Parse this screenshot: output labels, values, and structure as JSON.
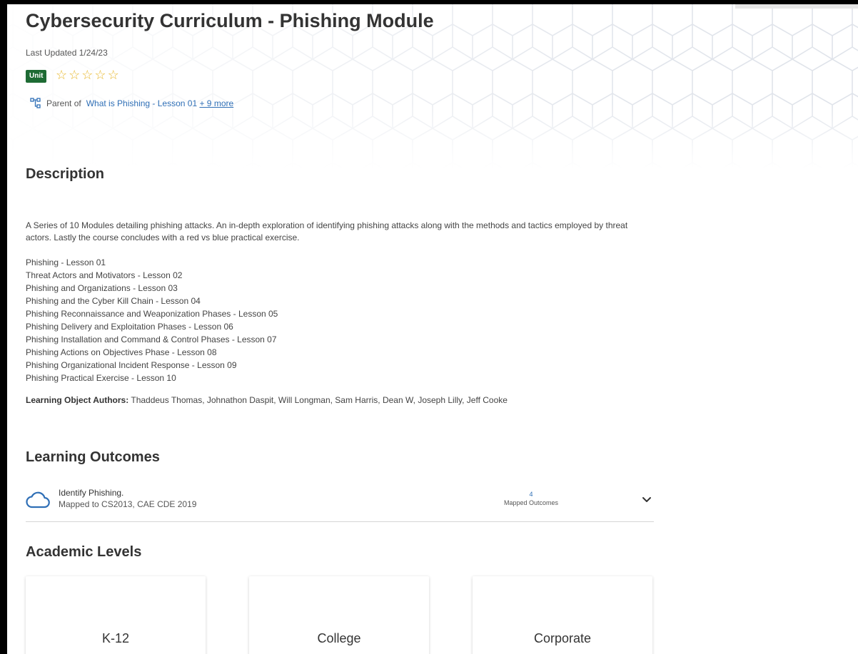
{
  "header": {
    "title": "Cybersecurity Curriculum - Phishing Module",
    "last_updated": "Last Updated 1/24/23",
    "badge": "Unit",
    "rating": {
      "value": 0,
      "max": 5
    },
    "parent_prefix": "Parent of",
    "parent_link": "What is Phishing - Lesson 01",
    "more_link": "+ 9 more"
  },
  "description": {
    "heading": "Description",
    "summary": "A Series of 10 Modules detailing phishing attacks. An in-depth exploration of identifying phishing attacks along with the methods and tactics employed by threat actors. Lastly the course concludes with a red vs blue practical exercise.",
    "lessons": [
      "Phishing - Lesson 01",
      "Threat Actors and Motivators - Lesson 02",
      "Phishing and Organizations - Lesson 03",
      "Phishing and the Cyber Kill Chain - Lesson 04",
      "Phishing Reconnaissance and Weaponization Phases - Lesson 05",
      "Phishing Delivery and Exploitation Phases - Lesson 06",
      "Phishing Installation and Command & Control Phases - Lesson 07",
      "Phishing Actions on Objectives Phase - Lesson 08",
      "Phishing Organizational Incident Response - Lesson 09",
      "Phishing Practical Exercise - Lesson 10"
    ],
    "authors_label": "Learning Object Authors:",
    "authors": "Thaddeus Thomas, Johnathon Daspit, Will Longman, Sam Harris, Dean W, Joseph Lilly, Jeff Cooke"
  },
  "outcomes": {
    "heading": "Learning Outcomes",
    "items": [
      {
        "title": "Identify Phishing.",
        "mapped_to": "Mapped to CS2013, CAE CDE 2019",
        "mapped_count": "4",
        "mapped_label": "Mapped Outcomes"
      }
    ]
  },
  "academic_levels": {
    "heading": "Academic Levels",
    "items": [
      "K-12",
      "College",
      "Corporate"
    ]
  },
  "colors": {
    "badge_bg": "#1e6b34",
    "star": "#e8b72b",
    "link": "#2f6fb6",
    "hex_pattern": "#dfe3ea"
  },
  "icons": {
    "star": "star-outline-icon",
    "hierarchy": "hierarchy-icon",
    "outcome": "cloud-icon",
    "expand": "chevron-down-icon"
  }
}
